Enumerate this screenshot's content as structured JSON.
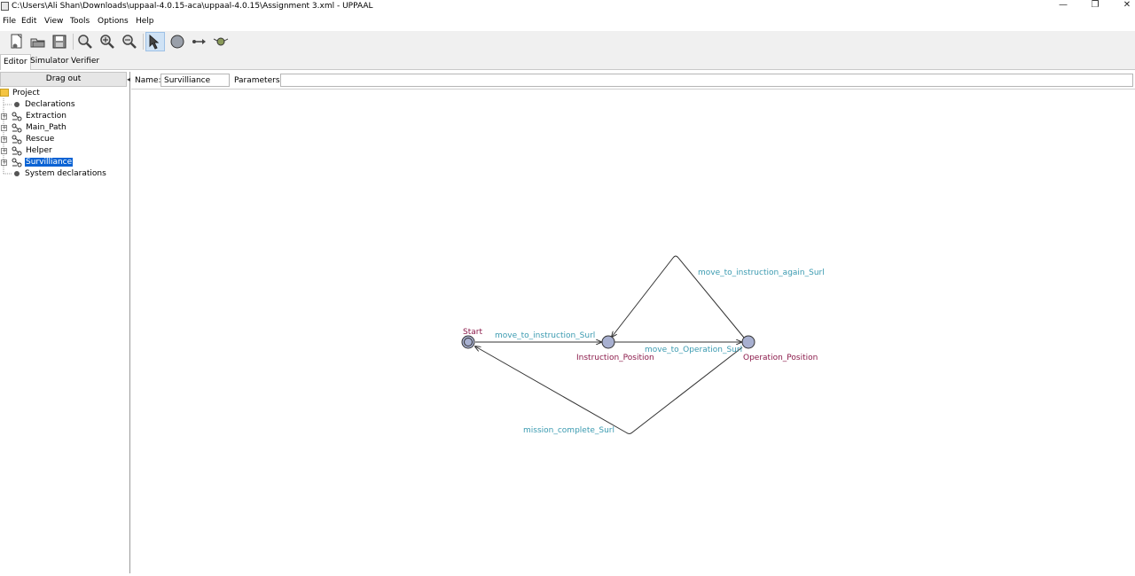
{
  "window": {
    "title": "C:\\Users\\Ali Shan\\Downloads\\uppaal-4.0.15-aca\\uppaal-4.0.15\\Assignment 3.xml - UPPAAL",
    "minimize": "—",
    "restore": "❐",
    "close": "✕"
  },
  "menu": [
    "File",
    "Edit",
    "View",
    "Tools",
    "Options",
    "Help"
  ],
  "toolbar": {
    "buttons": [
      "new-document-icon",
      "open-folder-icon",
      "save-icon",
      "zoom-to-fit-icon",
      "zoom-in-icon",
      "zoom-out-icon",
      "select-tool-icon",
      "add-location-icon",
      "add-edge-icon",
      "add-nail-icon"
    ]
  },
  "tabs": [
    "Editor",
    "Simulator",
    "Verifier"
  ],
  "project": {
    "drag_out": "Drag out",
    "root": "Project",
    "declarations": "Declarations",
    "templates": [
      "Extraction",
      "Main_Path",
      "Rescue",
      "Helper",
      "Survilliance"
    ],
    "selected": "Survilliance",
    "system_declarations": "System declarations"
  },
  "template_header": {
    "name_label": "Name:",
    "name_value": "Survilliance",
    "parameters_label": "Parameters:",
    "parameters_value": ""
  },
  "automaton": {
    "locations": [
      "Start",
      "Instruction_Position",
      "Operation_Position"
    ],
    "initial": "Start",
    "edges": [
      {
        "from": "Start",
        "to": "Instruction_Position",
        "sync": "move_to_instruction_Surl"
      },
      {
        "from": "Instruction_Position",
        "to": "Operation_Position",
        "sync": "move_to_Operation_Surl"
      },
      {
        "from": "Operation_Position",
        "to": "Instruction_Position",
        "sync": "move_to_instruction_again_Surl"
      },
      {
        "from": "Operation_Position",
        "to": "Start",
        "sync": "mission_complete_Surl"
      }
    ],
    "colors": {
      "location_name": "#8b1a4a",
      "sync_label": "#3a9ab0",
      "location_fill": "#a8b0d0"
    }
  }
}
